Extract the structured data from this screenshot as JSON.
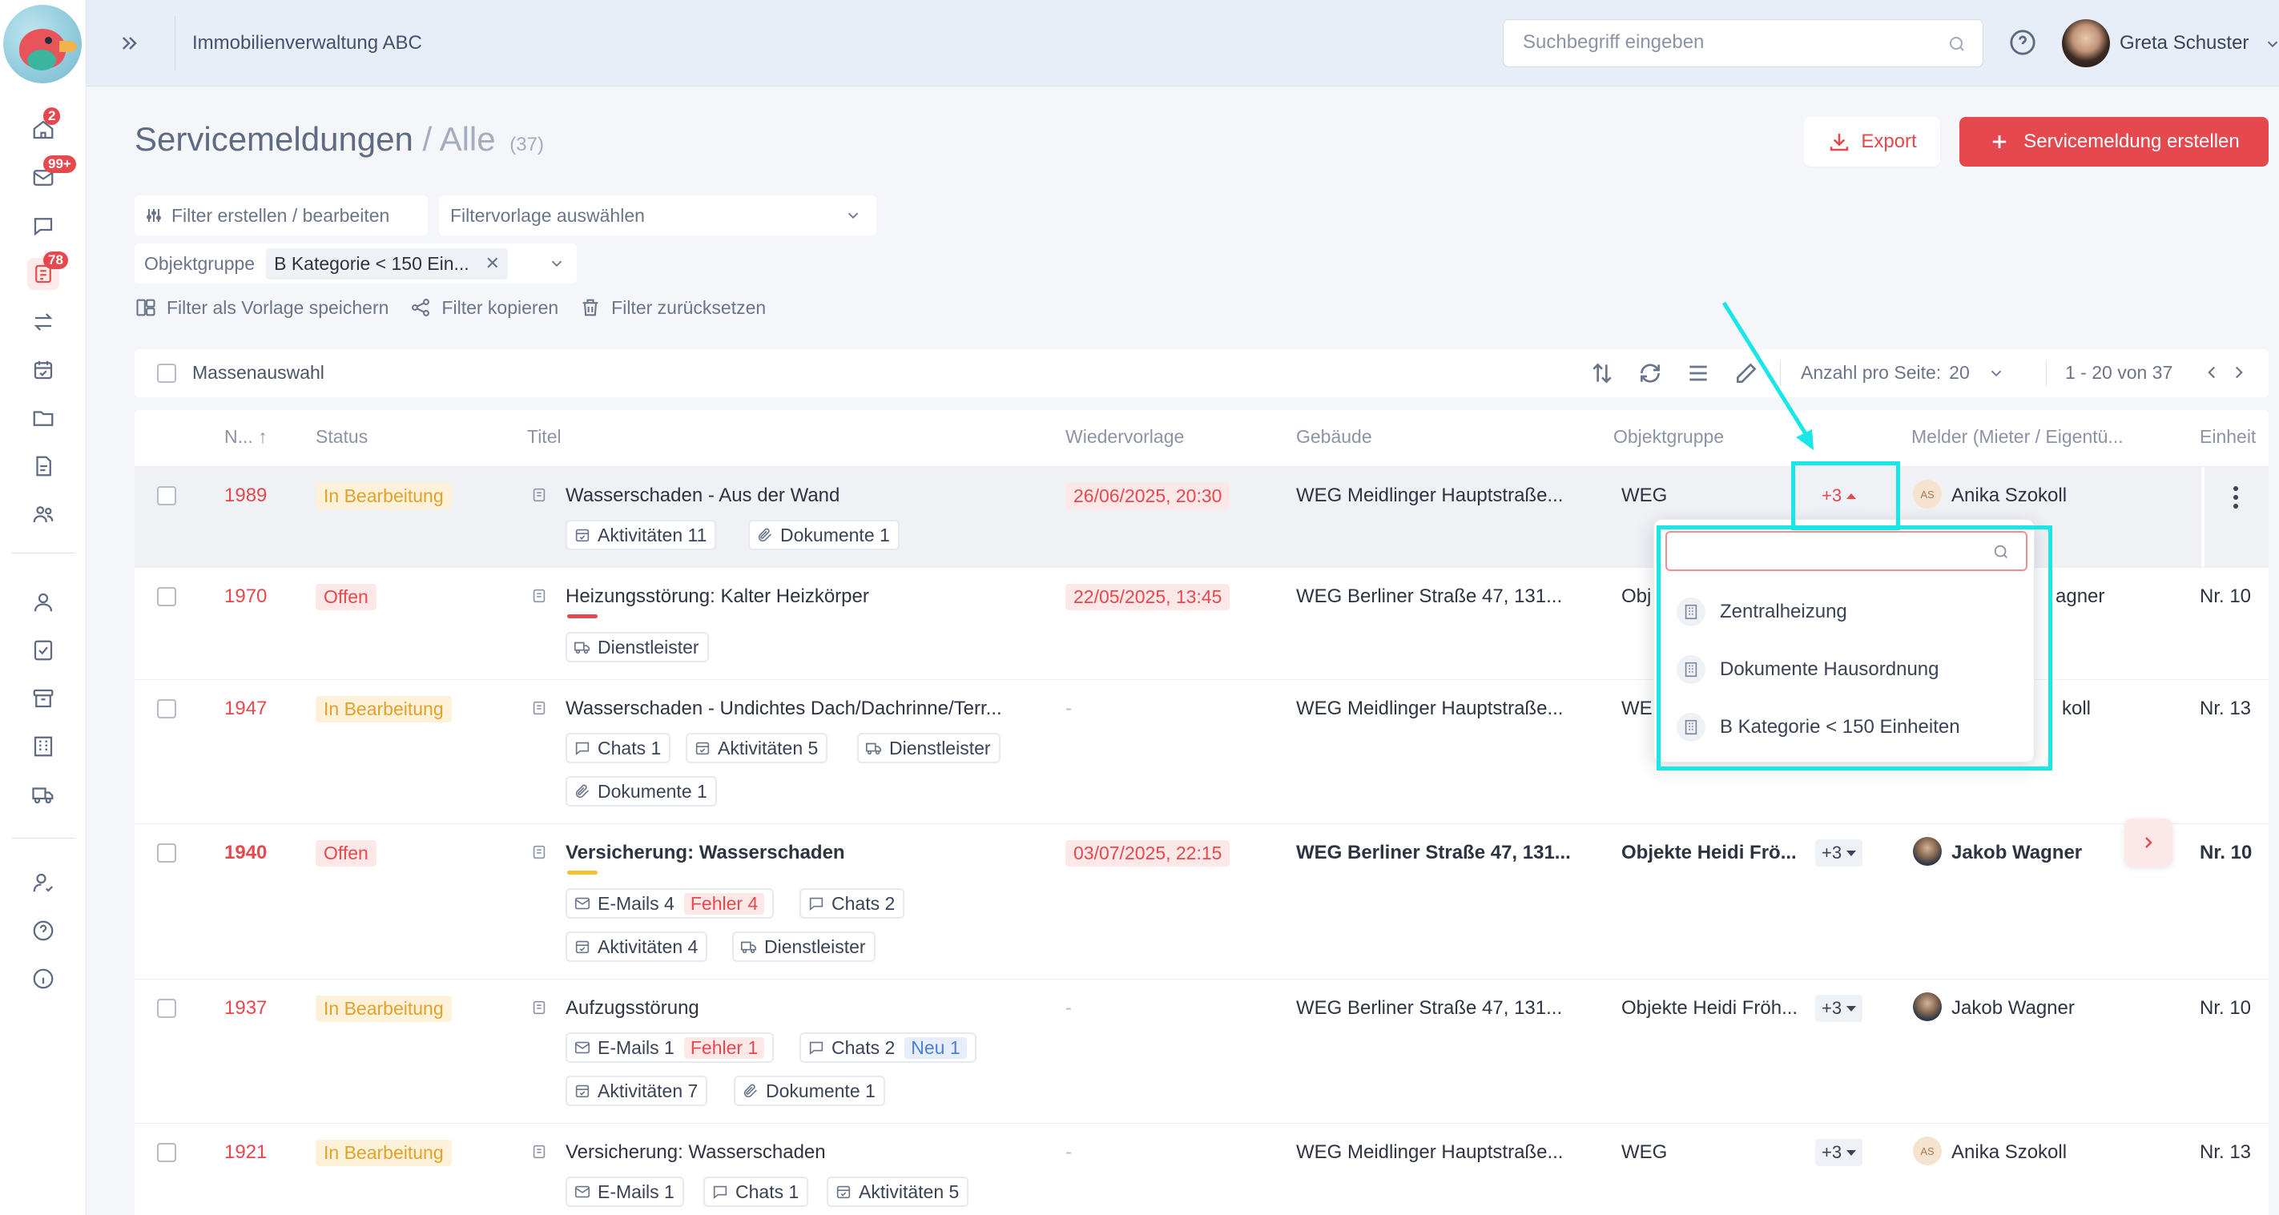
{
  "app": {
    "title": "Immobilienverwaltung ABC"
  },
  "sidebar": {
    "badges": {
      "home": "2",
      "mail": "99+",
      "service": "78"
    },
    "icons": [
      "home-icon",
      "mail-icon",
      "chat-icon",
      "service-report-icon",
      "transfer-icon",
      "calendar-check-icon",
      "folder-icon",
      "document-icon",
      "users-icon",
      "person-icon",
      "contract-icon",
      "archive-icon",
      "building-icon",
      "truck-icon",
      "user-check-icon",
      "help-icon",
      "info-icon"
    ]
  },
  "search": {
    "placeholder": "Suchbegriff eingeben"
  },
  "user": {
    "name": "Greta Schuster"
  },
  "header": {
    "title": "Servicemeldungen",
    "separator": "/",
    "subtitle": "Alle",
    "count": "(37)"
  },
  "buttons": {
    "export": "Export",
    "create": "Servicemeldung erstellen"
  },
  "filters": {
    "edit": "Filter erstellen / bearbeiten",
    "template_select": "Filtervorlage auswählen",
    "chip_label": "Objektgruppe",
    "chip_value": "B Kategorie < 150 Ein...",
    "save_template": "Filter als Vorlage speichern",
    "copy": "Filter kopieren",
    "reset": "Filter zurücksetzen"
  },
  "toolbar": {
    "mass_select": "Massenauswahl",
    "per_page_label": "Anzahl pro Seite:",
    "per_page_value": "20",
    "range": "1 - 20 von 37"
  },
  "table": {
    "headers": [
      "N...",
      "Status",
      "Titel",
      "Wiedervorlage",
      "Gebäude",
      "Objektgruppe",
      "Melder (Mieter / Eigentü...",
      "Einheit"
    ],
    "rows": [
      {
        "num": "1989",
        "status": "In Bearbeitung",
        "title": "Wasserschaden - Aus der Wand",
        "tags": [
          {
            "icon": "calendar-icon",
            "label": "Aktivitäten 11"
          },
          {
            "icon": "paperclip-icon",
            "label": "Dokumente 1"
          }
        ],
        "date": "26/06/2025, 20:30",
        "building": "WEG Meidlinger Hauptstraße...",
        "group": "WEG",
        "more": "+3",
        "reporter": "Anika Szokoll",
        "reporter_initials": "AS",
        "unit": ""
      },
      {
        "num": "1970",
        "status": "Offen",
        "title": "Heizungsstörung: Kalter Heizkörper",
        "tags": [
          {
            "icon": "truck-icon",
            "label": "Dienstleister"
          }
        ],
        "date": "22/05/2025, 13:45",
        "building": "WEG Berliner Straße 47, 131...",
        "group": "Obj",
        "more": "",
        "reporter": "agner",
        "reporter_initials": "",
        "unit": "Nr. 10"
      },
      {
        "num": "1947",
        "status": "In Bearbeitung",
        "title": "Wasserschaden - Undichtes Dach/Dachrinne/Terr...",
        "tags": [
          {
            "icon": "chat-icon",
            "label": "Chats 1"
          },
          {
            "icon": "calendar-icon",
            "label": "Aktivitäten 5"
          },
          {
            "icon": "truck-icon",
            "label": "Dienstleister"
          },
          {
            "icon": "paperclip-icon",
            "label": "Dokumente 1"
          }
        ],
        "date": "-",
        "building": "WEG Meidlinger Hauptstraße...",
        "group": "WE",
        "more": "",
        "reporter": "koll",
        "reporter_initials": "",
        "unit": "Nr. 13"
      },
      {
        "num": "1940",
        "status": "Offen",
        "title": "Versicherung: Wasserschaden",
        "tags": [
          {
            "icon": "mail-icon",
            "label": "E-Mails 4",
            "error": "Fehler 4"
          },
          {
            "icon": "chat-icon",
            "label": "Chats 2"
          },
          {
            "icon": "calendar-icon",
            "label": "Aktivitäten 4"
          },
          {
            "icon": "truck-icon",
            "label": "Dienstleister"
          }
        ],
        "date": "03/07/2025, 22:15",
        "building": "WEG Berliner Straße 47, 131...",
        "group": "Objekte Heidi Frö...",
        "more": "+3",
        "reporter": "Jakob Wagner",
        "reporter_initials": "",
        "unit": "Nr. 10"
      },
      {
        "num": "1937",
        "status": "In Bearbeitung",
        "title": "Aufzugsstörung",
        "tags": [
          {
            "icon": "mail-icon",
            "label": "E-Mails 1",
            "error": "Fehler 1"
          },
          {
            "icon": "chat-icon",
            "label": "Chats 2",
            "new": "Neu 1"
          },
          {
            "icon": "calendar-icon",
            "label": "Aktivitäten 7"
          },
          {
            "icon": "paperclip-icon",
            "label": "Dokumente 1"
          }
        ],
        "date": "-",
        "building": "WEG Berliner Straße 47, 131...",
        "group": "Objekte Heidi Fröh...",
        "more": "+3",
        "reporter": "Jakob Wagner",
        "reporter_initials": "",
        "unit": "Nr. 10"
      },
      {
        "num": "1921",
        "status": "In Bearbeitung",
        "title": "Versicherung: Wasserschaden",
        "tags": [
          {
            "icon": "mail-icon",
            "label": "E-Mails 1"
          },
          {
            "icon": "chat-icon",
            "label": "Chats 1"
          },
          {
            "icon": "calendar-icon",
            "label": "Aktivitäten 5"
          }
        ],
        "date": "-",
        "building": "WEG Meidlinger Hauptstraße...",
        "group": "WEG",
        "more": "+3",
        "reporter": "Anika Szokoll",
        "reporter_initials": "AS",
        "unit": "Nr. 13"
      }
    ]
  },
  "dropdown": {
    "search_value": "",
    "items": [
      "Zentralheizung",
      "Dokumente Hausordnung",
      "B Kategorie < 150 Einheiten"
    ]
  },
  "colors": {
    "accent": "#e5484d",
    "status_in_progress": "#e2a22a",
    "annotation": "#19e6e6"
  }
}
